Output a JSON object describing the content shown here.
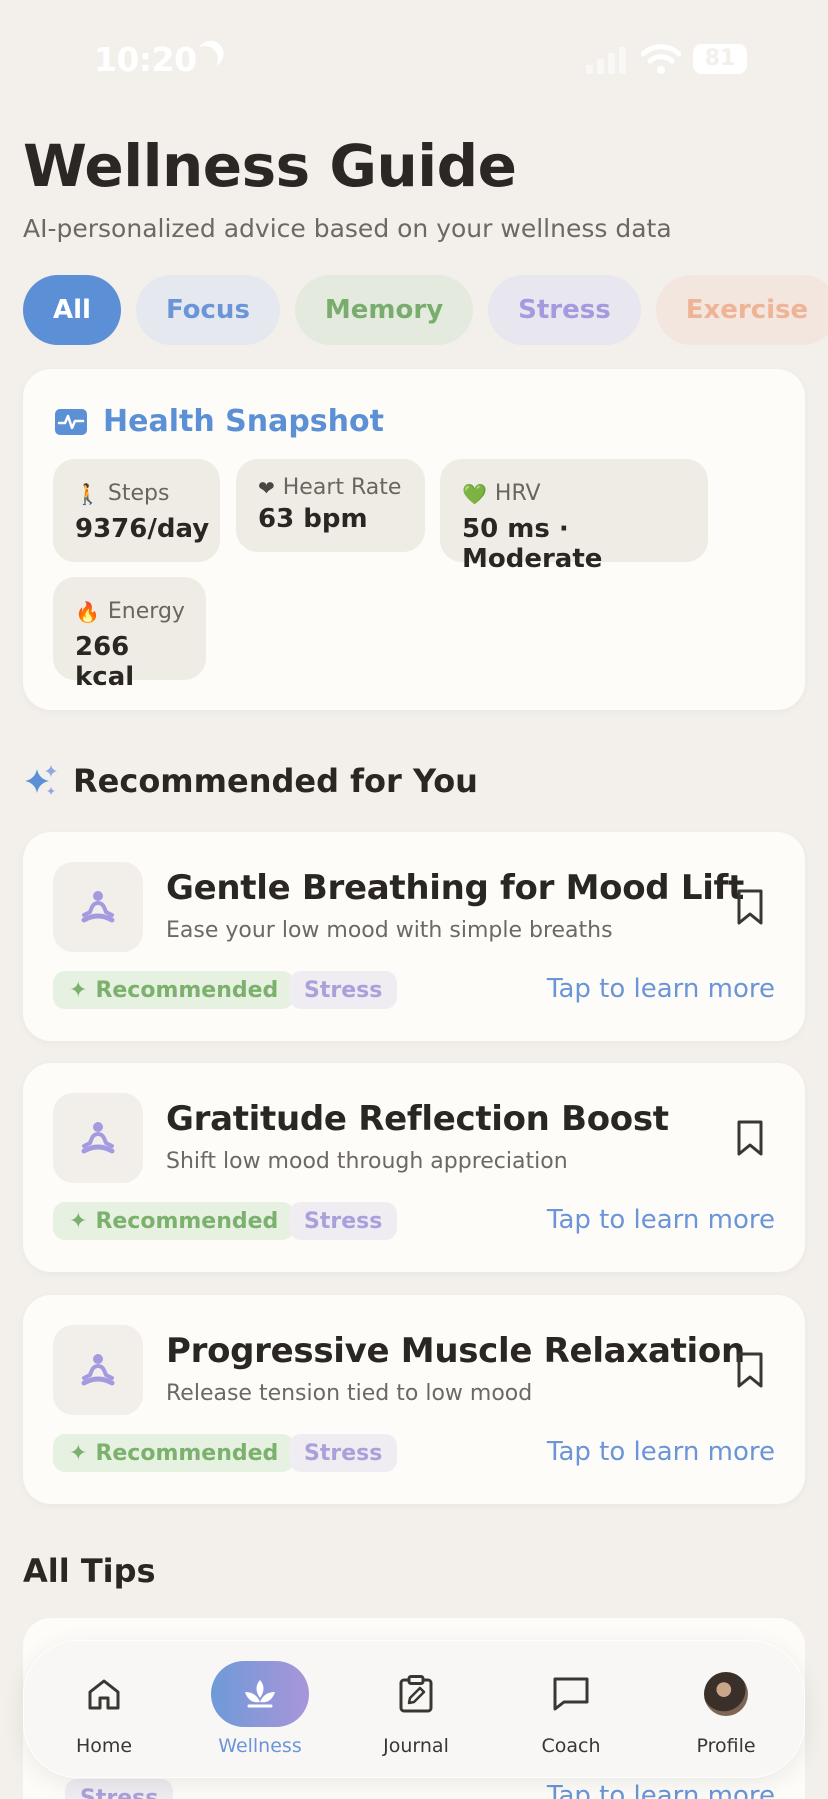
{
  "status_bar": {
    "time": "10:20",
    "battery": "81"
  },
  "header": {
    "title": "Wellness Guide",
    "subtitle": "AI-personalized advice based on your wellness data"
  },
  "filters": [
    "All",
    "Focus",
    "Memory",
    "Stress",
    "Exercise"
  ],
  "snapshot": {
    "title": "Health Snapshot",
    "metrics": [
      {
        "icon": "walking-person-icon",
        "label": "Steps",
        "value": "9376/day"
      },
      {
        "icon": "heart-icon",
        "label": "Heart Rate",
        "value": "63 bpm"
      },
      {
        "icon": "green-heart-icon",
        "label": "HRV",
        "value": "50 ms · Moderate"
      },
      {
        "icon": "fire-icon",
        "label": "Energy",
        "value": "266 kcal"
      }
    ]
  },
  "recommended": {
    "heading": "Recommended for You",
    "tips": [
      {
        "title": "Gentle Breathing for Mood Lift",
        "desc": "Ease your low mood with simple breaths",
        "tag": "Recommended",
        "category": "Stress",
        "cta": "Tap to learn more"
      },
      {
        "title": "Gratitude Reflection Boost",
        "desc": "Shift low mood through appreciation",
        "tag": "Recommended",
        "category": "Stress",
        "cta": "Tap to learn more"
      },
      {
        "title": "Progressive Muscle Relaxation",
        "desc": "Release tension tied to low mood",
        "tag": "Recommended",
        "category": "Stress",
        "cta": "Tap to learn more"
      }
    ]
  },
  "all_tips": {
    "heading": "All Tips",
    "partial": {
      "category": "Stress",
      "cta": "Tap to learn more"
    }
  },
  "tab_bar": {
    "active": "Wellness",
    "tabs": [
      {
        "label": "Home",
        "icon": "home-icon"
      },
      {
        "label": "Wellness",
        "icon": "lotus-icon"
      },
      {
        "label": "Journal",
        "icon": "clipboard-edit-icon"
      },
      {
        "label": "Coach",
        "icon": "chat-bubble-icon"
      },
      {
        "label": "Profile",
        "icon": "avatar"
      }
    ]
  },
  "colors": {
    "background": "#f3f0ec",
    "accent_blue": "#5b8fd6",
    "green": "#79ad6e",
    "lavender": "#a49adf",
    "peach": "#efb395"
  }
}
